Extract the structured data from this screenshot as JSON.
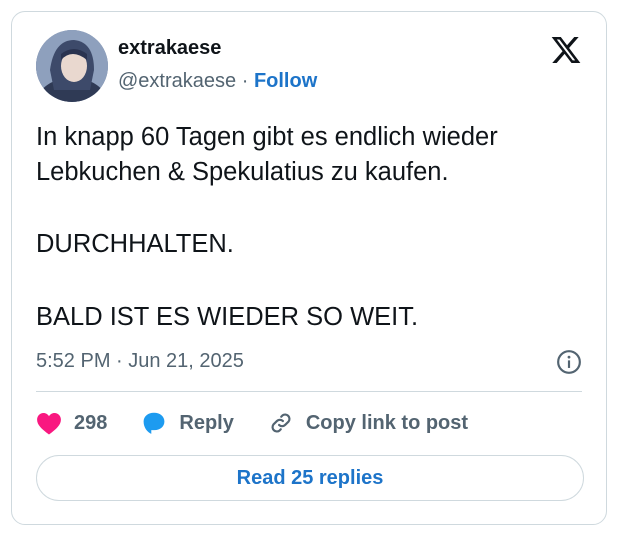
{
  "author": {
    "display_name": "extrakaese",
    "handle": "@extrakaese",
    "separator": "·",
    "follow_label": "Follow"
  },
  "tweet": {
    "lines": [
      "In knapp 60 Tagen gibt es endlich wieder",
      "Lebkuchen & Spekulatius zu kaufen.",
      "DURCHHALTEN.",
      "BALD IST ES WIEDER SO WEIT."
    ],
    "timestamp": "5:52 PM · Jun 21, 2025"
  },
  "actions": {
    "like_count": "298",
    "reply_label": "Reply",
    "copy_label": "Copy link to post"
  },
  "read_replies_label": "Read 25 replies",
  "icons": [
    "x-logo-icon",
    "info-icon",
    "heart-icon",
    "reply-bubble-icon",
    "link-icon"
  ],
  "colors": {
    "accent": "#1d74c9",
    "heart": "#f91880",
    "muted": "#536471",
    "border": "#cfd9de"
  }
}
